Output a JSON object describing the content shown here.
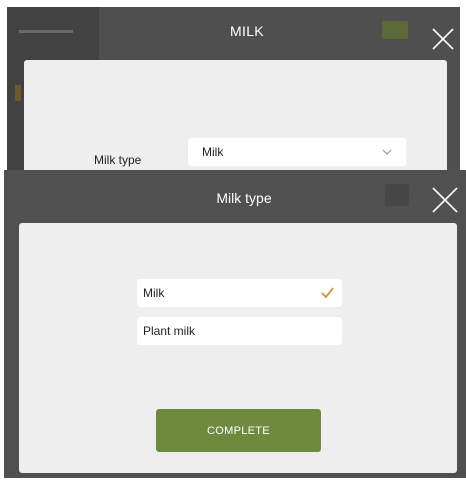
{
  "background_screen": {
    "title": "MILK",
    "field_label": "Milk type",
    "select_value": "Milk"
  },
  "modal": {
    "title": "Milk type",
    "options": [
      {
        "label": "Milk",
        "selected": true
      },
      {
        "label": "Plant milk",
        "selected": false
      }
    ],
    "complete_label": "COMPLETE"
  },
  "colors": {
    "header_dark": "#4f4f4f",
    "card_bg": "#eeeeee",
    "accent_check": "#e08a2c",
    "button_green": "#6e8a3f"
  },
  "icons": {
    "close": "close-icon",
    "dropdown": "chevron-down-icon",
    "selected": "check-icon"
  }
}
